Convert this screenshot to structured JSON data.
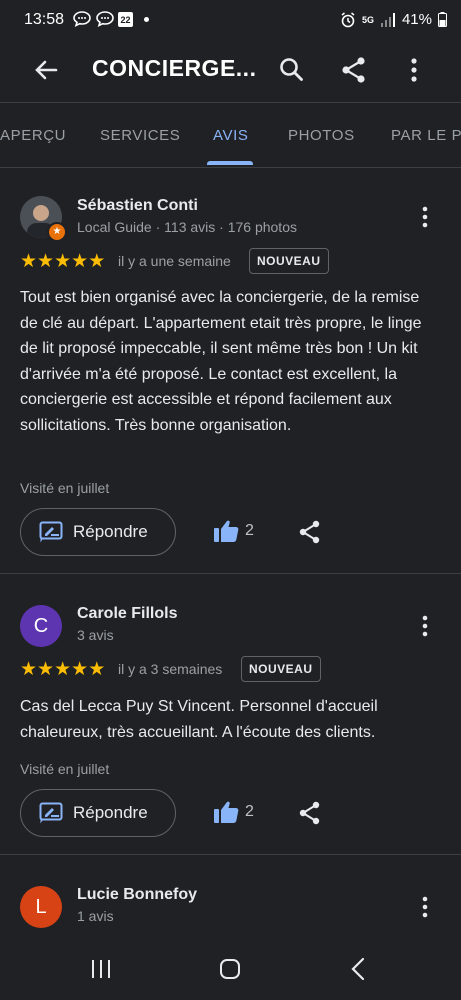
{
  "status": {
    "time": "13:58",
    "calendar_day": "22",
    "network": "5G",
    "battery": "41%"
  },
  "appbar": {
    "title": "CONCIERGE..."
  },
  "tabs": [
    {
      "label": "APERÇU"
    },
    {
      "label": "SERVICES"
    },
    {
      "label": "AVIS"
    },
    {
      "label": "PHOTOS"
    },
    {
      "label": "PAR LE PR"
    }
  ],
  "reviews": [
    {
      "author": "Sébastien Conti",
      "meta": "Local Guide · 113 avis · 176 photos",
      "rating": 5,
      "when": "il y a une semaine",
      "badge": "NOUVEAU",
      "text": "Tout est bien organisé avec la conciergerie, de la remise de clé au départ. L'appartement etait très propre, le linge de lit proposé impeccable, il sent même très bon ! Un kit d'arrivée m'a été proposé. Le contact est excellent, la conciergerie est accessible et répond facilement aux sollicitations. Très bonne organisation.",
      "visited": "Visité en juillet",
      "reply_label": "Répondre",
      "likes": "2"
    },
    {
      "author": "Carole Fillols",
      "initial": "C",
      "avatar_color": "#5e35b1",
      "meta": "3 avis",
      "rating": 5,
      "when": "il y a 3 semaines",
      "badge": "NOUVEAU",
      "text": "Cas del Lecca Puy St Vincent. Personnel d'accueil chaleureux, très accueillant. A l'écoute des clients.",
      "visited": "Visité en juillet",
      "reply_label": "Répondre",
      "likes": "2"
    },
    {
      "author": "Lucie Bonnefoy",
      "initial": "L",
      "avatar_color": "#d84315",
      "meta": "1 avis"
    }
  ],
  "colors": {
    "background": "#202124",
    "accent": "#8ab4f8",
    "star": "#fbbc04"
  }
}
